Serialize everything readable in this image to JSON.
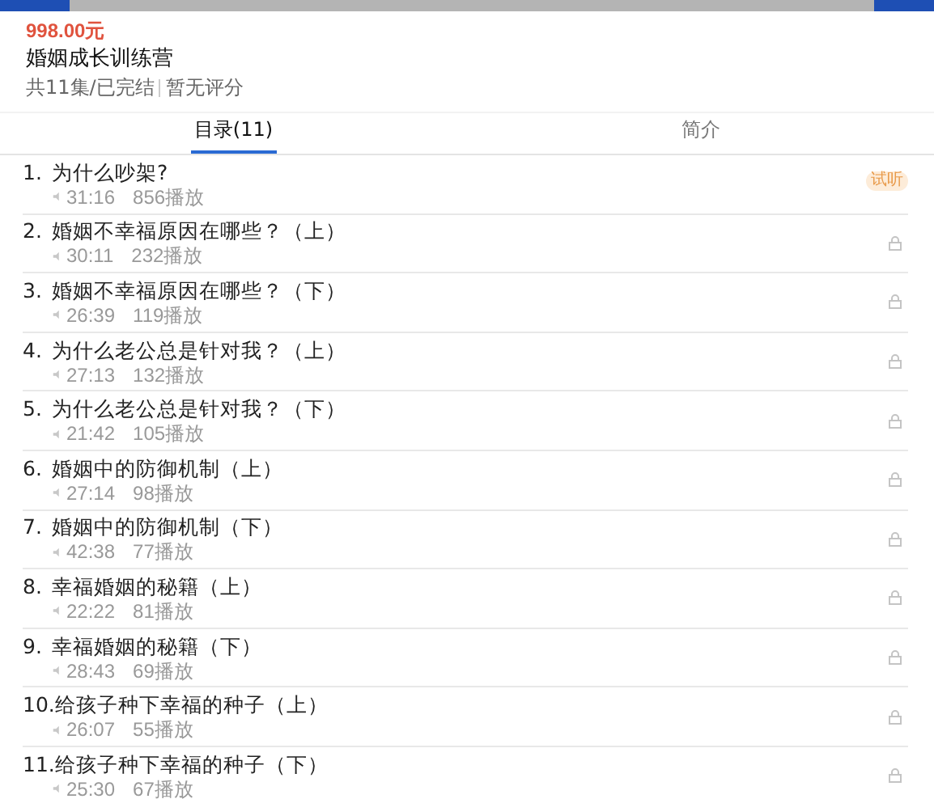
{
  "course": {
    "price": "998.00元",
    "title": "婚姻成长训练营",
    "episodes": "共11集/已完结",
    "rating": "暂无评分"
  },
  "tabs": [
    {
      "label": "目录(11)",
      "selected": true
    },
    {
      "label": "简介",
      "selected": false
    }
  ],
  "lessons": [
    {
      "number": "1.",
      "title": "为什么吵架?",
      "duration": "31:16",
      "plays": "856播放",
      "kind": "trial",
      "badge": "试听"
    },
    {
      "number": "2.",
      "title": "婚姻不幸福原因在哪些？（上）",
      "duration": "30:11",
      "plays": "232播放",
      "kind": "locked"
    },
    {
      "number": "3.",
      "title": "婚姻不幸福原因在哪些？（下）",
      "duration": "26:39",
      "plays": "119播放",
      "kind": "locked"
    },
    {
      "number": "4.",
      "title": "为什么老公总是针对我？（上）",
      "duration": "27:13",
      "plays": "132播放",
      "kind": "locked"
    },
    {
      "number": "5.",
      "title": "为什么老公总是针对我？（下）",
      "duration": "21:42",
      "plays": "105播放",
      "kind": "locked"
    },
    {
      "number": "6.",
      "title": "婚姻中的防御机制（上）",
      "duration": "27:14",
      "plays": "98播放",
      "kind": "locked"
    },
    {
      "number": "7.",
      "title": "婚姻中的防御机制（下）",
      "duration": "42:38",
      "plays": "77播放",
      "kind": "locked"
    },
    {
      "number": "8.",
      "title": "幸福婚姻的秘籍（上）",
      "duration": "22:22",
      "plays": "81播放",
      "kind": "locked"
    },
    {
      "number": "9.",
      "title": "幸福婚姻的秘籍（下）",
      "duration": "28:43",
      "plays": "69播放",
      "kind": "locked"
    },
    {
      "number": "10.",
      "title": "给孩子种下幸福的种子（上）",
      "duration": "26:07",
      "plays": "55播放",
      "kind": "locked"
    },
    {
      "number": "11.",
      "title": "给孩子种下幸福的种子（下）",
      "duration": "25:30",
      "plays": "67播放",
      "kind": "locked"
    }
  ]
}
